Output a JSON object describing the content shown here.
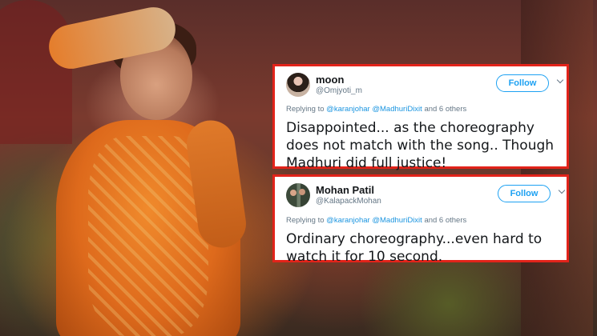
{
  "tweets": [
    {
      "name": "moon",
      "handle": "@Omjyoti_m",
      "follow_label": "Follow",
      "replying_prefix": "Replying to",
      "mention1": "@karanjohar",
      "mention2": "@MadhuriDixit",
      "replying_suffix": "and 6 others",
      "text": "Disappointed... as the choreography does not match with the song.. Though Madhuri did full justice!"
    },
    {
      "name": "Mohan Patil",
      "handle": "@KalapackMohan",
      "follow_label": "Follow",
      "replying_prefix": "Replying to",
      "mention1": "@karanjohar",
      "mention2": "@MadhuriDixit",
      "replying_suffix": "and 6 others",
      "text": "Ordinary choreography...even hard to watch it for 10 second."
    }
  ],
  "icons": {
    "menu": "chevron-down-icon"
  },
  "colors": {
    "highlight_border": "#e2231a",
    "twitter_blue": "#1da1f2",
    "mention_blue": "#1b95e0"
  }
}
